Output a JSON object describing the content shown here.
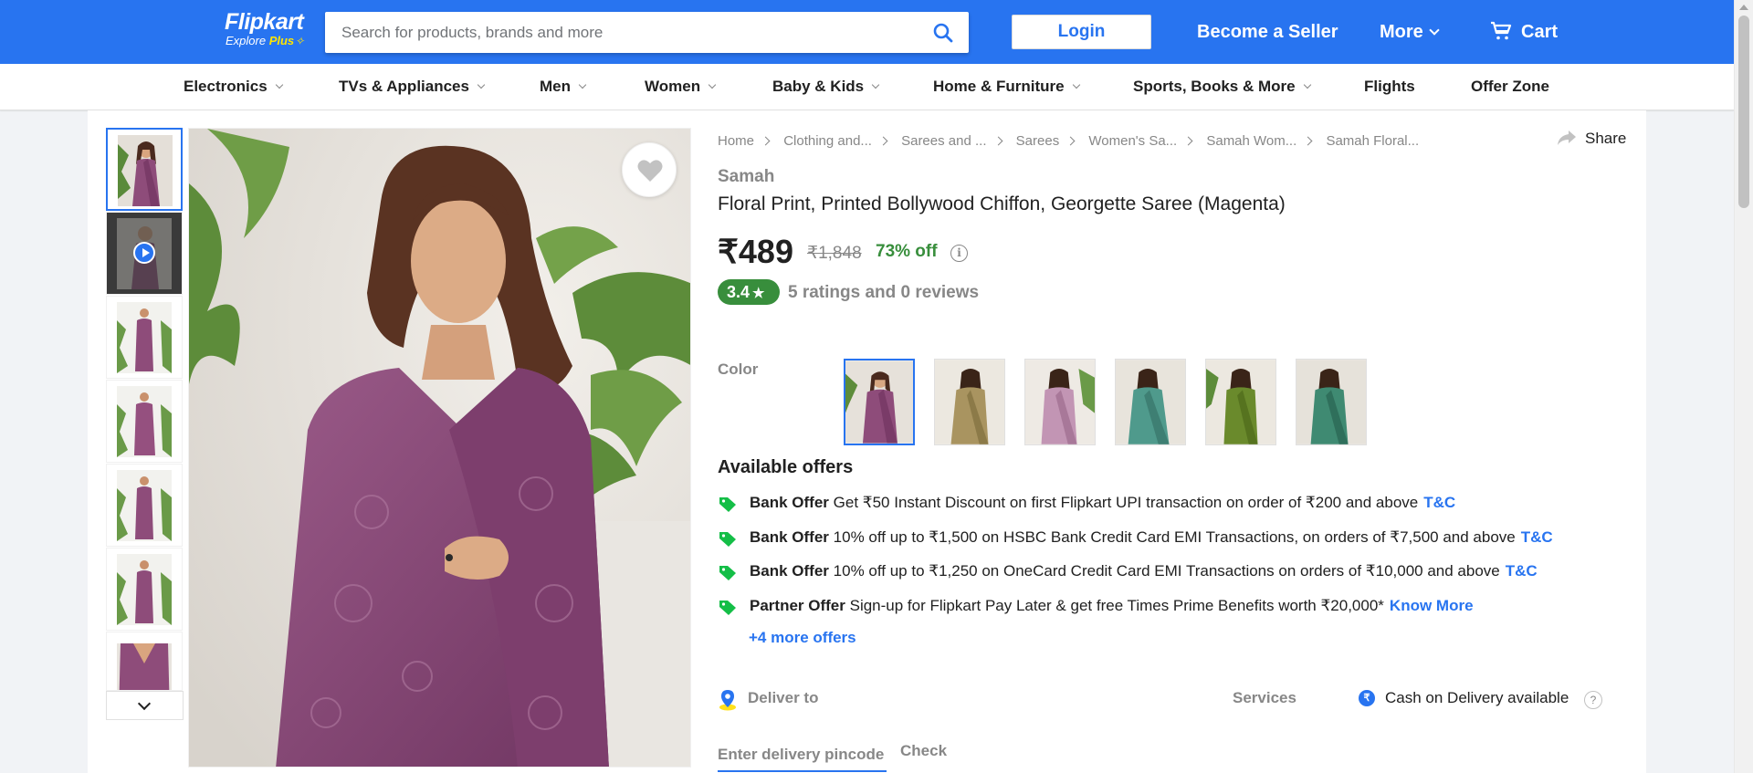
{
  "header": {
    "logo": {
      "brand": "Flipkart",
      "tagline_prefix": "Explore",
      "tagline_plus": "Plus"
    },
    "search": {
      "placeholder": "Search for products, brands and more"
    },
    "login_label": "Login",
    "seller_label": "Become a Seller",
    "more_label": "More",
    "cart_label": "Cart",
    "color": "#2874f0"
  },
  "categories": [
    "Electronics",
    "TVs & Appliances",
    "Men",
    "Women",
    "Baby & Kids",
    "Home & Furniture",
    "Sports, Books & More",
    "Flights",
    "Offer Zone"
  ],
  "breadcrumbs": [
    "Home",
    "Clothing and...",
    "Sarees and ...",
    "Sarees",
    "Women's Sa...",
    "Samah Wom...",
    "Samah Floral..."
  ],
  "share_label": "Share",
  "product": {
    "brand": "Samah",
    "title": "Floral Print, Printed Bollywood Chiffon, Georgette Saree  (Magenta)",
    "price": "₹489",
    "mrp": "₹1,848",
    "discount": "73% off",
    "rating": "3.4",
    "rating_text": "5 ratings and 0 reviews"
  },
  "color_label": "Color",
  "offers": {
    "heading": "Available offers",
    "items": [
      {
        "type": "Bank Offer",
        "text": "Get ₹50 Instant Discount on first Flipkart UPI transaction on order of ₹200 and above",
        "link": "T&C"
      },
      {
        "type": "Bank Offer",
        "text": "10% off up to ₹1,500 on HSBC Bank Credit Card EMI Transactions, on orders of ₹7,500 and above",
        "link": "T&C"
      },
      {
        "type": "Bank Offer",
        "text": "10% off up to ₹1,250 on OneCard Credit Card EMI Transactions on orders of ₹10,000 and above",
        "link": "T&C"
      },
      {
        "type": "Partner Offer",
        "text": "Sign-up for Flipkart Pay Later & get free Times Prime Benefits worth ₹20,000*",
        "link": "Know More"
      }
    ],
    "more_label": "+4 more offers"
  },
  "delivery": {
    "deliver_to_label": "Deliver to",
    "pincode_placeholder": "Enter delivery pincode",
    "check_label": "Check",
    "services_label": "Services",
    "cod_text": "Cash on Delivery available"
  },
  "colors": {
    "price_green": "#388e3c",
    "link_blue": "#2874f0",
    "muted": "#878787"
  }
}
